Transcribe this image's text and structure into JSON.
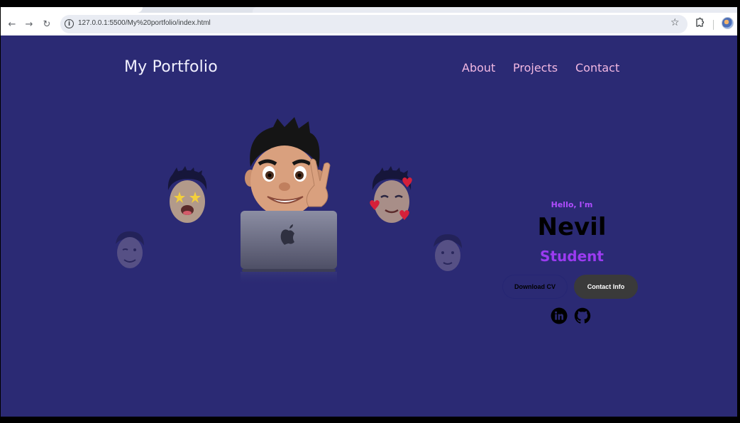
{
  "browser": {
    "url": "127.0.0.1:5500/My%20portfolio/index.html",
    "icons": [
      "back-icon",
      "forward-icon",
      "reload-icon",
      "site-info-icon",
      "bookmark-star-icon",
      "extensions-icon",
      "profile-icon"
    ]
  },
  "header": {
    "logo": "My Portfolio",
    "nav": [
      {
        "label": "About"
      },
      {
        "label": "Projects"
      },
      {
        "label": "Contact"
      }
    ]
  },
  "hero": {
    "greeting": "Hello, I'm",
    "name": "Nevil",
    "role": "Student",
    "buttons": {
      "download_cv": "Download CV",
      "contact_info": "Contact Info"
    },
    "social": [
      "linkedin-icon",
      "github-icon"
    ]
  },
  "colors": {
    "page_background": "#2b2a74",
    "logo_text": "#f2f1ff",
    "nav_link": "#f2b8e2",
    "greeting": "#b04dff",
    "role": "#9b3bf0",
    "contact_button": "#3a3a3a"
  }
}
